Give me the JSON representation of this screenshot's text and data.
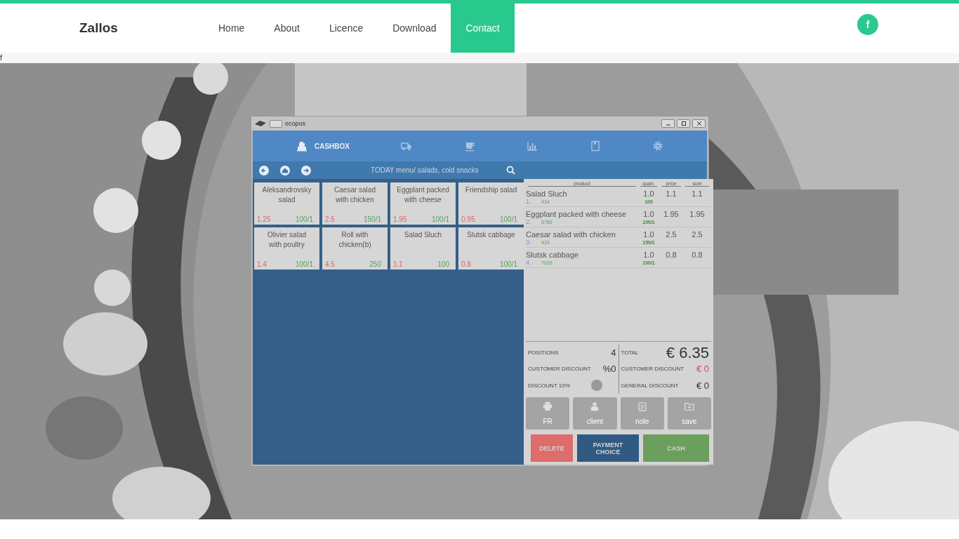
{
  "header": {
    "logo": "Zallos",
    "nav": [
      {
        "label": "Home",
        "selected": false
      },
      {
        "label": "About",
        "selected": false
      },
      {
        "label": "Licence",
        "selected": false
      },
      {
        "label": "Download",
        "selected": false
      },
      {
        "label": "Contact",
        "selected": true
      }
    ],
    "social": "f"
  },
  "stray_text": "f",
  "hero": {
    "kind": "picture",
    "app_window": {
      "title": "ecopos",
      "toolbar": [
        {
          "kind": "register",
          "label": "CASHBOX",
          "selected": true
        },
        {
          "kind": "truck",
          "selected": false
        },
        {
          "kind": "cup",
          "selected": false
        },
        {
          "kind": "chart",
          "selected": false
        },
        {
          "kind": "book",
          "selected": false
        },
        {
          "kind": "gear",
          "selected": false
        }
      ],
      "breadcrumb": "TODAY menu/ salads, cold snacks",
      "products": [
        {
          "name": "Aleksandrovsky salad",
          "price": "1.25",
          "weight": "100/1"
        },
        {
          "name": "Caesar salad with chicken",
          "price": "2.5",
          "weight": "150/1"
        },
        {
          "name": "Eggplant packed with cheese",
          "price": "1.95",
          "weight": "100/1"
        },
        {
          "name": "Friendship salad",
          "price": "0.95",
          "weight": "100/1"
        },
        {
          "name": "Olivier salad with poultry",
          "price": "1.4",
          "weight": "100/1"
        },
        {
          "name": "Roll with chicken(b)",
          "price": "4.5",
          "weight": "250"
        },
        {
          "name": "Salad Sluch",
          "price": "1.1",
          "weight": "100"
        },
        {
          "name": "Slutsk cabbage",
          "price": "0.8",
          "weight": "100/1"
        }
      ],
      "order_columns": [
        "product",
        "quan.",
        "price",
        "sum"
      ],
      "order_rows": [
        {
          "index": "1.",
          "name": "Salad Sluch",
          "code": "414",
          "weight": "100",
          "quantity": "1.0",
          "price": "1.1",
          "sum": "1.1"
        },
        {
          "index": "2.",
          "name": "Eggplant packed with cheese",
          "code": "6789",
          "weight": "100/1",
          "quantity": "1.0",
          "price": "1.95",
          "sum": "1.95"
        },
        {
          "index": "3.",
          "name": "Caesar salad with chicken",
          "code": "423",
          "weight": "150/1",
          "quantity": "1.0",
          "price": "2.5",
          "sum": "2.5"
        },
        {
          "index": "4.",
          "name": "Slutsk cabbage",
          "code": "7039",
          "weight": "100/1",
          "quantity": "1.0",
          "price": "0.8",
          "sum": "0.8"
        }
      ],
      "summary_left": [
        {
          "kind": "value",
          "label": "POSITIONS",
          "value": "4"
        },
        {
          "kind": "value",
          "label": "CUSTOMER DISCOUNT",
          "value": "%0"
        },
        {
          "kind": "toggle",
          "label": "DISCOUNT 10%",
          "on": false
        }
      ],
      "summary_right": [
        {
          "kind": "total",
          "label": "TOTAL",
          "value": "€ 6.35"
        },
        {
          "kind": "alert",
          "label": "CUSTOMER DISCOUNT",
          "value": "€ 0"
        },
        {
          "kind": "plain",
          "label": "GENERAL DISCOUNT",
          "value": "€ 0"
        }
      ],
      "tools": [
        {
          "kind": "printer",
          "label": "FR"
        },
        {
          "kind": "person",
          "label": "client"
        },
        {
          "kind": "note",
          "label": "note"
        },
        {
          "kind": "folder",
          "label": "save"
        }
      ],
      "actions": [
        {
          "kind": "delete",
          "label": "DELETE"
        },
        {
          "kind": "payment",
          "label": "PAYMENT CHOICE"
        },
        {
          "kind": "cash",
          "label": "CASH"
        }
      ]
    }
  }
}
